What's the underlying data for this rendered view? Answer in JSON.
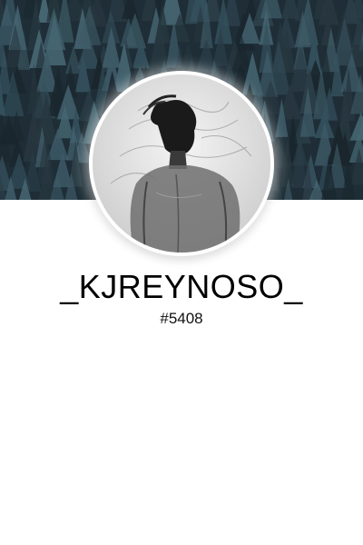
{
  "profile": {
    "username": "_KJREYNOSO_",
    "discriminator": "#5408"
  },
  "banner": {
    "icon": "pine-forest-banner",
    "color": "#1e2d36"
  },
  "avatar": {
    "icon": "silhouette-avatar"
  }
}
